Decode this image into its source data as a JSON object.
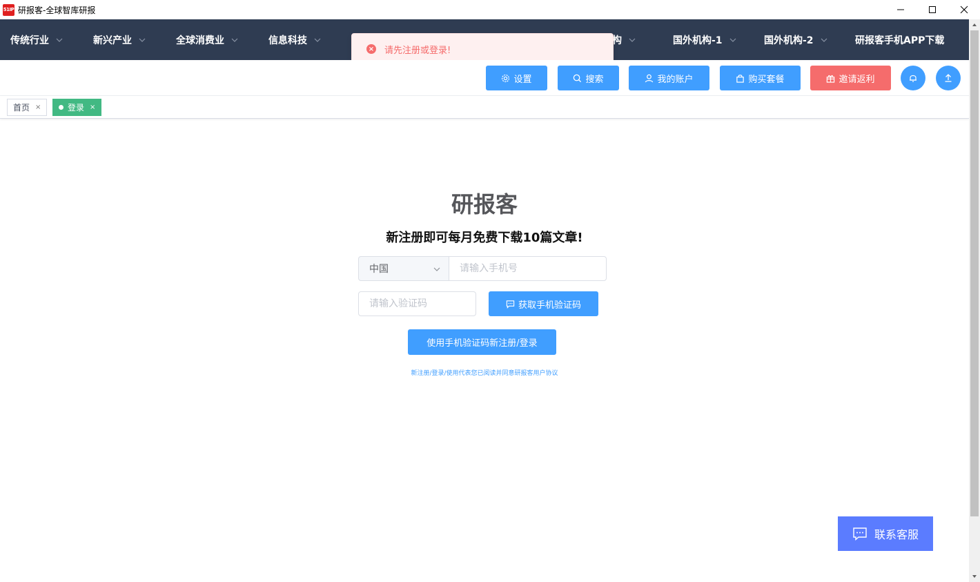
{
  "window": {
    "icon_text": "51IP",
    "title": "研报客-全球智库研报"
  },
  "nav": {
    "items": [
      {
        "label": "传统行业"
      },
      {
        "label": "新兴产业"
      },
      {
        "label": "全球消费业"
      },
      {
        "label": "信息科技"
      },
      {
        "label": "机构"
      },
      {
        "label": "国外机构-1"
      },
      {
        "label": "国外机构-2"
      },
      {
        "label": "研报客手机APP下载"
      }
    ]
  },
  "toast": {
    "message": "请先注册或登录!",
    "type": "error"
  },
  "actions": {
    "settings": "设置",
    "search": "搜索",
    "account": "我的账户",
    "buy": "购买套餐",
    "invite": "邀请返利"
  },
  "tabs": [
    {
      "label": "首页",
      "active": false
    },
    {
      "label": "登录",
      "active": true
    }
  ],
  "login": {
    "brand": "研报客",
    "promo": "新注册即可每月免费下载10篇文章!",
    "country": "中国",
    "phone_placeholder": "请输入手机号",
    "code_placeholder": "请输入验证码",
    "get_code": "获取手机验证码",
    "submit": "使用手机验证码新注册/登录",
    "agreement": "新注册/登录/使用代表您已阅读并同意研报客用户协议"
  },
  "contact": {
    "label": "联系客服"
  },
  "colors": {
    "nav_bg": "#2f3c52",
    "primary": "#409eff",
    "danger": "#f56c6c",
    "tab_active": "#42b983",
    "contact_bg": "#5b7cff"
  }
}
